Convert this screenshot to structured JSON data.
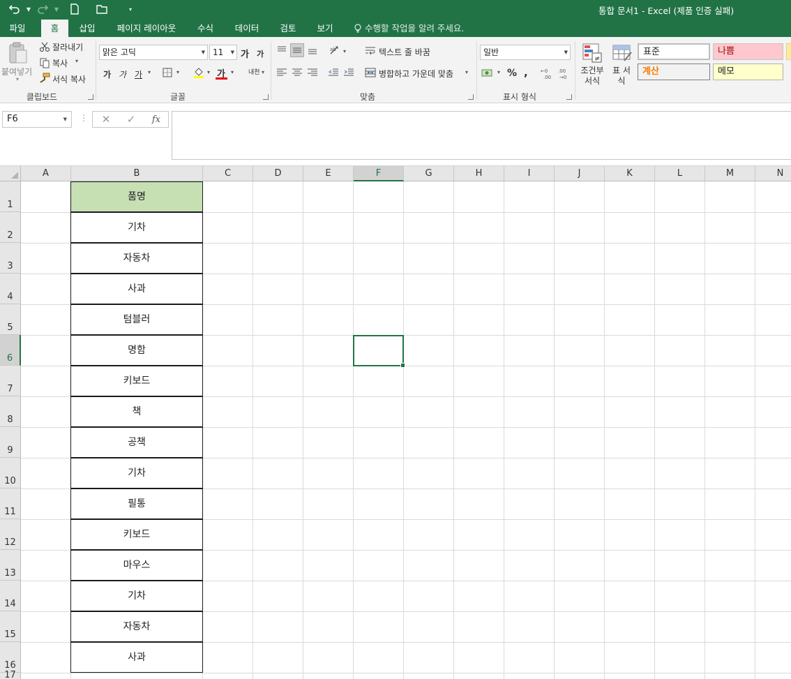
{
  "window": {
    "title": "통합 문서1 - Excel (제품 인증 실패)"
  },
  "ribbon_tabs": [
    "파일",
    "홈",
    "삽입",
    "페이지 레이아웃",
    "수식",
    "데이터",
    "검토",
    "보기"
  ],
  "active_tab": "홈",
  "tell_me": "수행할 작업을 알려 주세요.",
  "clipboard": {
    "paste": "붙여넣기",
    "cut": "잘라내기",
    "copy": "복사",
    "format_painter": "서식 복사",
    "label": "클립보드"
  },
  "font": {
    "name": "맑은 고딕",
    "size": "11",
    "grow": "가",
    "shrink": "가",
    "bold": "가",
    "italic": "가",
    "underline": "가",
    "color_a": "가",
    "phonetic": "내천",
    "label": "글꼴"
  },
  "alignment": {
    "wrap_text": "텍스트 줄 바꿈",
    "merge_center": "병합하고 가운데 맞춤",
    "label": "맞춤"
  },
  "number": {
    "format": "일반",
    "percent": "%",
    "comma": ",",
    "label": "표시 형식"
  },
  "styles": {
    "conditional": "조건부 서식",
    "table": "표 서식",
    "normal": "표준",
    "bad": "나쁨",
    "calculation": "계산",
    "note": "메모"
  },
  "colors": {
    "accent": "#217346",
    "header_fill": "#c6e0b4",
    "bad_bg": "#ffc7ce",
    "bad_text": "#9c0006",
    "calc_text": "#fa7d00",
    "note_bg": "#ffffcc"
  },
  "name_box": "F6",
  "formula_bar": {
    "cancel": "✕",
    "enter": "✓",
    "fx": "fx",
    "content": ""
  },
  "columns": [
    "A",
    "B",
    "C",
    "D",
    "E",
    "F",
    "G",
    "H",
    "I",
    "J",
    "K",
    "L",
    "M",
    "N"
  ],
  "selected_column": "F",
  "selected_row": "6",
  "rows": [
    "1",
    "2",
    "3",
    "4",
    "5",
    "6",
    "7",
    "8",
    "9",
    "10",
    "11",
    "12",
    "13",
    "14",
    "15",
    "16",
    "17"
  ],
  "column_b": [
    "품명",
    "기차",
    "자동차",
    "사과",
    "텀블러",
    "명함",
    "키보드",
    "책",
    "공책",
    "기차",
    "필통",
    "키보드",
    "마우스",
    "기차",
    "자동차",
    "사과"
  ]
}
